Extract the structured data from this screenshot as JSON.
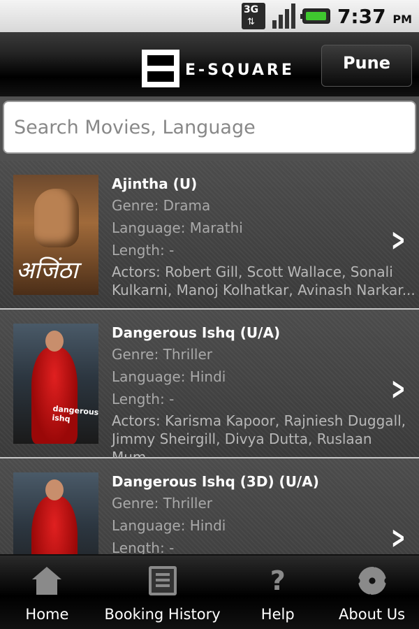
{
  "statusbar": {
    "network": "3G",
    "time": "7:37",
    "ampm": "PM"
  },
  "header": {
    "brand": "E-SQUARE",
    "city": "Pune"
  },
  "search": {
    "placeholder": "Search Movies, Language"
  },
  "movies": [
    {
      "title": "Ajintha (U)",
      "genre": "Genre: Drama",
      "language": "Language: Marathi",
      "length": "Length: -",
      "actors": "Actors: Robert Gill, Scott Wallace, Sonali Kulkarni, Manoj Kolhatkar, Avinash Narkar...",
      "poster_text": "अजिंठा"
    },
    {
      "title": "Dangerous Ishq (U/A)",
      "genre": "Genre: Thriller",
      "language": "Language: Hindi",
      "length": "Length: -",
      "actors": "Actors: Karisma Kapoor, Rajniesh Duggall, Jimmy Sheirgill, Divya Dutta, Ruslaan Mum...",
      "poster_text": "dangerous ishq"
    },
    {
      "title": "Dangerous Ishq (3D) (U/A)",
      "genre": "Genre: Thriller",
      "language": "Language: Hindi",
      "length": "Length: -",
      "actors": "",
      "poster_text": ""
    }
  ],
  "bottomnav": [
    {
      "label": "Home",
      "icon": "home-icon"
    },
    {
      "label": "Booking History",
      "icon": "booking-history-icon"
    },
    {
      "label": "Help",
      "icon": "help-icon",
      "glyph": "?"
    },
    {
      "label": "About Us",
      "icon": "gear-icon"
    }
  ],
  "colors": {
    "chevron": "#ffffff",
    "battery": "#3fc72f"
  }
}
